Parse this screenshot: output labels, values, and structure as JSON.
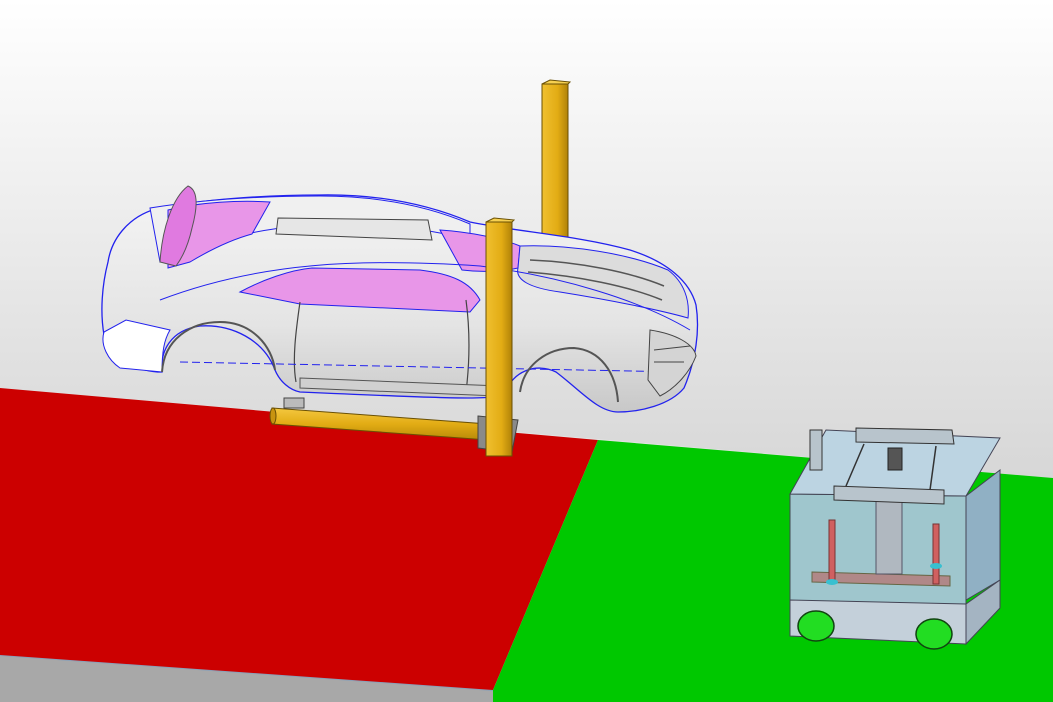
{
  "app": {
    "title": ""
  },
  "viewport": {
    "background_top": "#ffffff",
    "background_bottom": "#c4c4c4",
    "floor_color": "#e4e4e4",
    "edge_color": "#9aa8b8"
  },
  "zones": [
    {
      "name": "red-zone",
      "color": "#cc0000"
    },
    {
      "name": "green-zone",
      "color": "#00c800"
    }
  ],
  "objects": {
    "car_body": {
      "body_color": "#e8e8e8",
      "interior_color": "#e896e8",
      "outline_color": "#2222ee"
    },
    "lift_frame": {
      "color": "#e2ac14",
      "shade": "#b88a08"
    },
    "agv_cart": {
      "body_color": "#a8c6d8",
      "frame_color": "#909ca8",
      "post_color": "#d06060",
      "wheel_color": "#22dd22"
    }
  },
  "icons": [
    "car-body-icon",
    "lift-frame-icon",
    "agv-cart-icon"
  ]
}
